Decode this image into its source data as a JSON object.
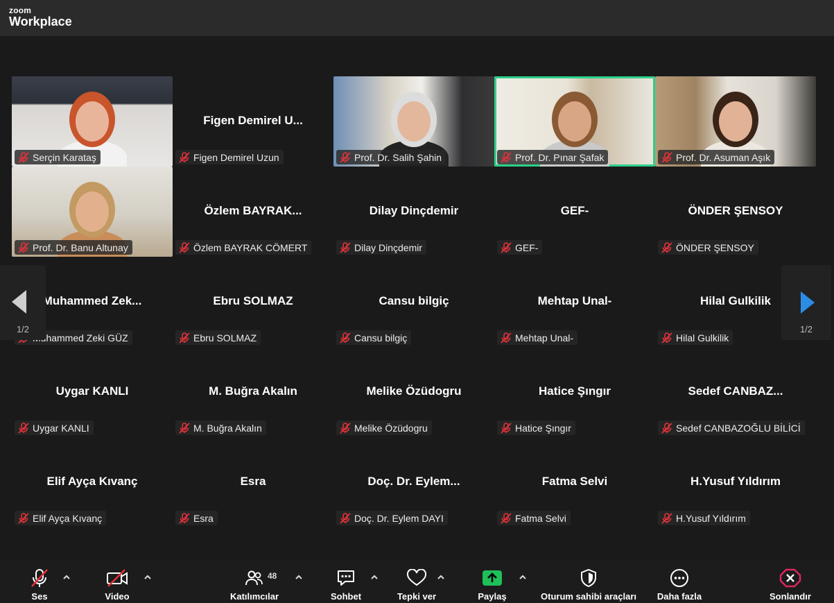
{
  "app": {
    "brand_top": "zoom",
    "brand_bottom": "Workplace"
  },
  "tiles": [
    {
      "big": "",
      "label": "Serçin Karataş",
      "video": true
    },
    {
      "big": "Figen  Demirel U...",
      "label": "Figen Demirel Uzun",
      "video": false
    },
    {
      "big": "",
      "label": "Prof. Dr. Salih Şahin",
      "video": true
    },
    {
      "big": "",
      "label": "Prof. Dr.  Pınar Şafak",
      "video": true,
      "speaking": true
    },
    {
      "big": "",
      "label": "Prof. Dr. Asuman Aşık",
      "video": true
    },
    {
      "big": "",
      "label": "Prof. Dr. Banu Altunay",
      "video": true
    },
    {
      "big": "Özlem  BAYRAK...",
      "label": "Özlem BAYRAK CÖMERT",
      "video": false
    },
    {
      "big": "Dilay  Dinçdemir",
      "label": "Dilay  Dinçdemir",
      "video": false
    },
    {
      "big": "GEF-",
      "label": "GEF-",
      "video": false
    },
    {
      "big": "ÖNDER ŞENSOY",
      "label": "ÖNDER ŞENSOY",
      "video": false
    },
    {
      "big": "Muhammed  Zek...",
      "label": "Muhammed Zeki GÜZ",
      "video": false
    },
    {
      "big": "Ebru SOLMAZ",
      "label": "Ebru SOLMAZ",
      "video": false
    },
    {
      "big": "Cansu bilgiç",
      "label": "Cansu bilgiç",
      "video": false
    },
    {
      "big": "Mehtap Unal-",
      "label": "Mehtap Unal-",
      "video": false
    },
    {
      "big": "Hilal Gulkilik",
      "label": "Hilal Gulkilik",
      "video": false
    },
    {
      "big": "Uygar KANLI",
      "label": "Uygar KANLI",
      "video": false
    },
    {
      "big": "M. Buğra Akalın",
      "label": "M. Buğra Akalın",
      "video": false
    },
    {
      "big": "Melike Özüdogru",
      "label": "Melike Özüdogru",
      "video": false
    },
    {
      "big": "Hatice Şıngır",
      "label": "Hatice Şıngır",
      "video": false
    },
    {
      "big": "Sedef  CANBAZ...",
      "label": "Sedef CANBAZOĞLU BİLİCİ",
      "video": false
    },
    {
      "big": "Elif Ayça Kıvanç",
      "label": "Elif Ayça Kıvanç",
      "video": false
    },
    {
      "big": "Esra",
      "label": "Esra",
      "video": false
    },
    {
      "big": "Doç.  Dr.  Eylem...",
      "label": "Doç. Dr. Eylem DAYI",
      "video": false
    },
    {
      "big": "Fatma Selvi",
      "label": "Fatma Selvi",
      "video": false
    },
    {
      "big": "H.Yusuf Yıldırım",
      "label": "H.Yusuf Yıldırım",
      "video": false
    }
  ],
  "pagination": {
    "left": "1/2",
    "right": "1/2"
  },
  "toolbar": {
    "mute": "Ses",
    "video": "Video",
    "participants": "Katılımcılar",
    "participants_count": "48",
    "chat": "Sohbet",
    "react": "Tepki ver",
    "share": "Paylaş",
    "host_tools": "Oturum sahibi araçları",
    "more": "Daha fazla",
    "end": "Sonlandır"
  },
  "colors": {
    "accent_green": "#2bd18a",
    "share_green": "#1fbf5a",
    "end_red": "#e0245e",
    "arrow_blue": "#2b8de6",
    "mute_red": "#e5323b"
  }
}
